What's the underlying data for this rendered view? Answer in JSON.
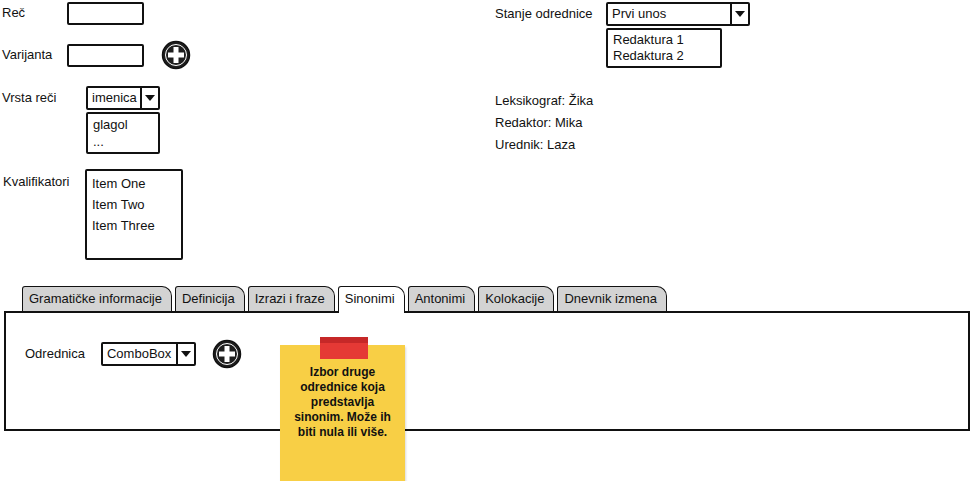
{
  "fields": {
    "word": {
      "label": "Reč"
    },
    "variant": {
      "label": "Varijanta"
    },
    "part_of_speech": {
      "label": "Vrsta reči",
      "value": "imenica",
      "options": [
        "glagol",
        "..."
      ],
      "expanded": true
    },
    "qualifiers": {
      "label": "Kvalifikatori",
      "items": [
        "Item One",
        "Item Two",
        "Item Three"
      ]
    }
  },
  "status": {
    "label": "Stanje odrednice",
    "value": "Prvi unos",
    "options": [
      "Redaktura 1",
      "Redaktura 2"
    ],
    "expanded": true
  },
  "people": [
    "Leksikograf: Žika",
    "Redaktor: Mika",
    "Urednik: Laza"
  ],
  "tabs": [
    {
      "label": "Gramatičke informacije",
      "selected": false
    },
    {
      "label": "Definicija",
      "selected": false
    },
    {
      "label": "Izrazi i fraze",
      "selected": false
    },
    {
      "label": "Sinonimi",
      "selected": true
    },
    {
      "label": "Antonimi",
      "selected": false
    },
    {
      "label": "Kolokacije",
      "selected": false
    },
    {
      "label": "Dnevnik izmena",
      "selected": false
    }
  ],
  "synonyms_panel": {
    "label": "Odrednica",
    "combo_value": "ComboBox"
  },
  "note": {
    "text": "Izbor druge odrednice koja predstavlja sinonim. Može ih biti nula ili više."
  }
}
